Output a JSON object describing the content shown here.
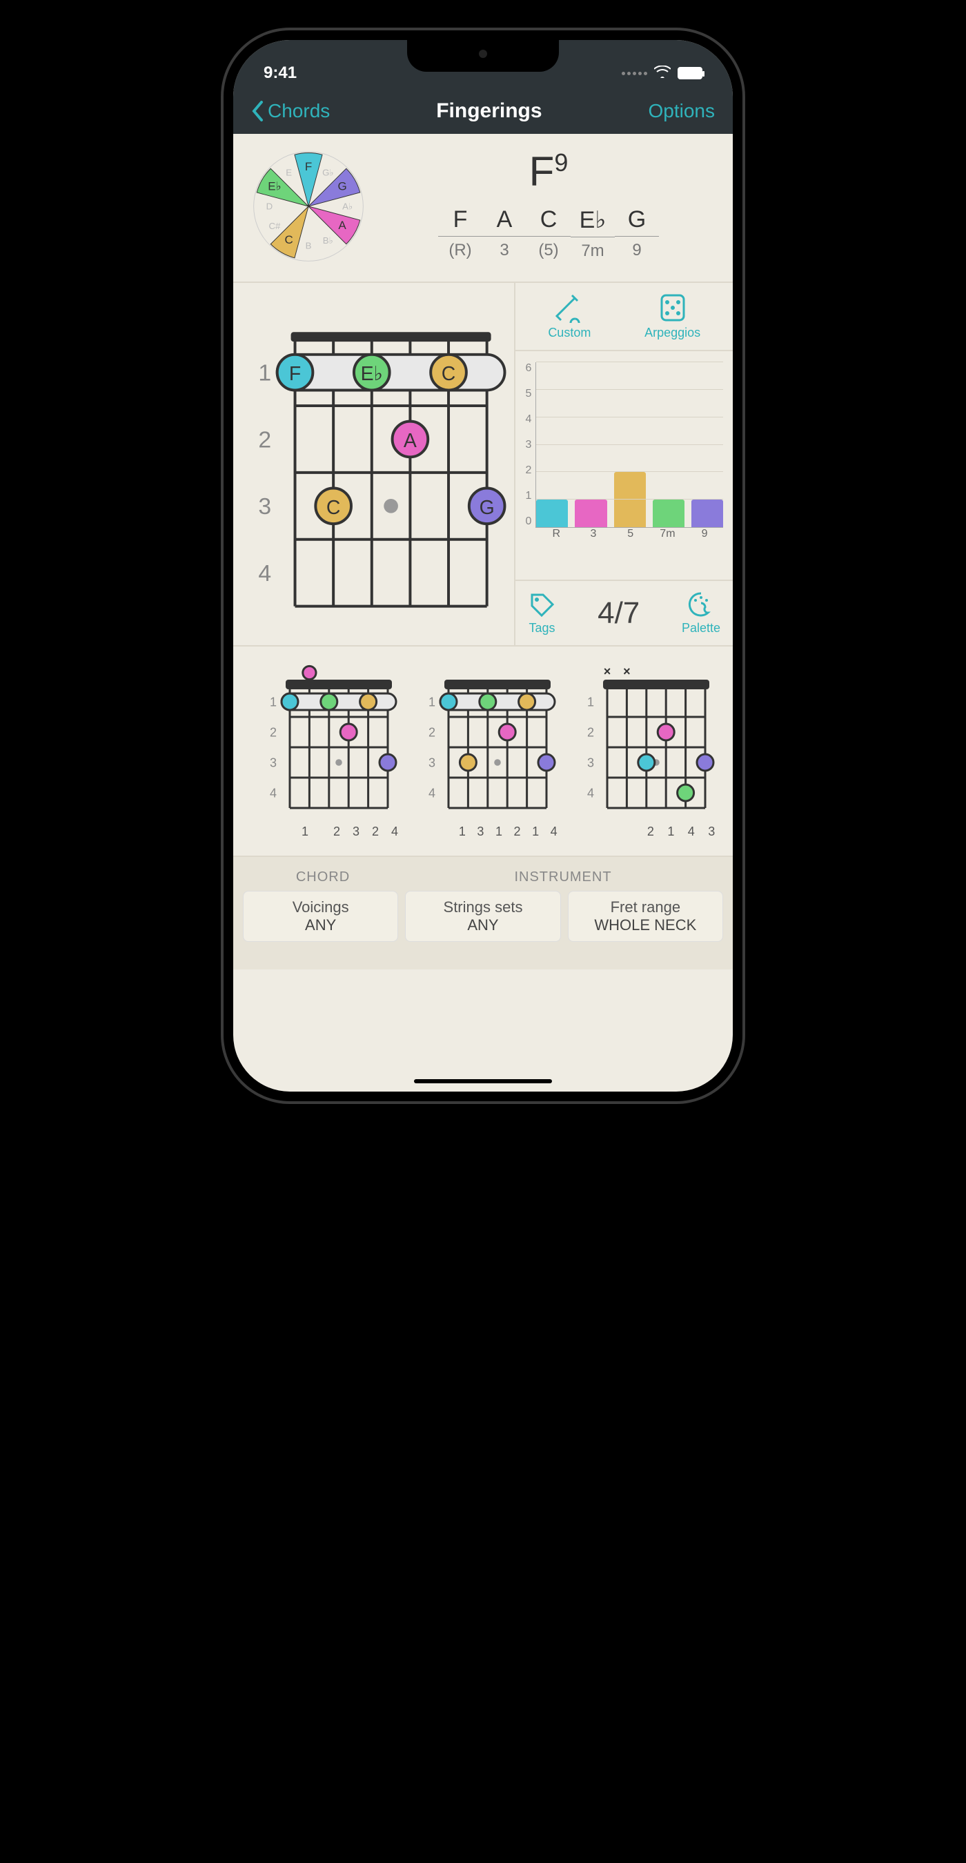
{
  "statusbar": {
    "time": "9:41"
  },
  "nav": {
    "back": "Chords",
    "title": "Fingerings",
    "options": "Options"
  },
  "chord": {
    "name": "F",
    "suffix": "9",
    "notes": [
      {
        "n": "F",
        "r": "(R)",
        "color": "#4bc6d6"
      },
      {
        "n": "A",
        "r": "3",
        "color": "#e767c3"
      },
      {
        "n": "C",
        "r": "(5)",
        "color": "#e2b95a"
      },
      {
        "n": "E♭",
        "r": "7m",
        "color": "#6ed47a"
      },
      {
        "n": "G",
        "r": "9",
        "color": "#8a7bdb"
      }
    ],
    "wheel_notes": [
      "F",
      "G♭",
      "G",
      "A♭",
      "A",
      "B♭",
      "B",
      "C",
      "C#",
      "D",
      "E♭",
      "E"
    ]
  },
  "right_buttons": {
    "custom": "Custom",
    "arpeggios": "Arpeggios",
    "tags": "Tags",
    "palette": "Palette"
  },
  "chart_data": {
    "type": "bar",
    "categories": [
      "R",
      "3",
      "5",
      "7m",
      "9"
    ],
    "values": [
      1,
      1,
      2,
      1,
      1
    ],
    "colors": [
      "#4bc6d6",
      "#e767c3",
      "#e2b95a",
      "#6ed47a",
      "#8a7bdb"
    ],
    "ylim": [
      0,
      6
    ],
    "yticks": [
      0,
      1,
      2,
      3,
      4,
      5,
      6
    ]
  },
  "position": "4/7",
  "main_fretboard": {
    "fret_labels": [
      "1",
      "2",
      "3",
      "4"
    ],
    "dots": [
      {
        "s": 0,
        "f": 1,
        "label": "F",
        "color": "#4bc6d6"
      },
      {
        "s": 2,
        "f": 1,
        "label": "E♭",
        "color": "#6ed47a"
      },
      {
        "s": 4,
        "f": 1,
        "label": "C",
        "color": "#e2b95a"
      },
      {
        "s": 3,
        "f": 2,
        "label": "A",
        "color": "#e767c3"
      },
      {
        "s": 1,
        "f": 3,
        "label": "C",
        "color": "#e2b95a"
      },
      {
        "s": 5,
        "f": 3,
        "label": "G",
        "color": "#8a7bdb"
      }
    ],
    "barre": {
      "fret": 1,
      "from": 0,
      "to": 5
    }
  },
  "thumbnails": [
    {
      "fret_labels": [
        "1",
        "2",
        "3",
        "4"
      ],
      "open": [
        {
          "s": 1,
          "color": "#e767c3"
        }
      ],
      "barre": {
        "fret": 1,
        "from": 0,
        "to": 5
      },
      "dots": [
        {
          "s": 0,
          "f": 1,
          "color": "#4bc6d6"
        },
        {
          "s": 2,
          "f": 1,
          "color": "#6ed47a"
        },
        {
          "s": 4,
          "f": 1,
          "color": "#e2b95a"
        },
        {
          "s": 3,
          "f": 2,
          "color": "#e767c3"
        },
        {
          "s": 5,
          "f": 3,
          "color": "#8a7bdb"
        }
      ],
      "fingers": [
        "1",
        "",
        "2",
        "3",
        "2",
        "4"
      ]
    },
    {
      "fret_labels": [
        "1",
        "2",
        "3",
        "4"
      ],
      "barre": {
        "fret": 1,
        "from": 0,
        "to": 5
      },
      "dots": [
        {
          "s": 0,
          "f": 1,
          "color": "#4bc6d6"
        },
        {
          "s": 2,
          "f": 1,
          "color": "#6ed47a"
        },
        {
          "s": 4,
          "f": 1,
          "color": "#e2b95a"
        },
        {
          "s": 3,
          "f": 2,
          "color": "#e767c3"
        },
        {
          "s": 1,
          "f": 3,
          "color": "#e2b95a"
        },
        {
          "s": 5,
          "f": 3,
          "color": "#8a7bdb"
        }
      ],
      "fingers": [
        "1",
        "3",
        "1",
        "2",
        "1",
        "4"
      ]
    },
    {
      "fret_labels": [
        "1",
        "2",
        "3",
        "4"
      ],
      "muted": [
        0,
        1
      ],
      "dots": [
        {
          "s": 3,
          "f": 2,
          "color": "#e767c3"
        },
        {
          "s": 2,
          "f": 3,
          "color": "#4bc6d6"
        },
        {
          "s": 5,
          "f": 3,
          "color": "#8a7bdb"
        },
        {
          "s": 4,
          "f": 4,
          "color": "#6ed47a"
        }
      ],
      "fingers": [
        "",
        "",
        "2",
        "1",
        "4",
        "3"
      ]
    }
  ],
  "filters": {
    "chord_header": "CHORD",
    "instrument_header": "INSTRUMENT",
    "buttons": [
      {
        "t1": "Voicings",
        "t2": "ANY"
      },
      {
        "t1": "Strings sets",
        "t2": "ANY"
      },
      {
        "t1": "Fret range",
        "t2": "WHOLE NECK"
      }
    ]
  }
}
